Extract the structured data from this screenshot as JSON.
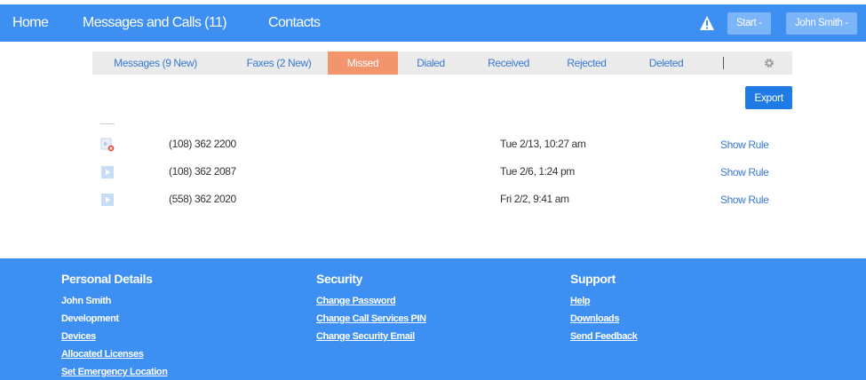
{
  "nav": {
    "home": "Home",
    "messages_calls": "Messages and Calls (11)",
    "contacts": "Contacts",
    "start_button": "Start -",
    "user_button": "John Smith -"
  },
  "tabs": {
    "messages": "Messages (9 New)",
    "faxes": "Faxes (2 New)",
    "missed": "Missed",
    "dialed": "Dialed",
    "received": "Received",
    "rejected": "Rejected",
    "deleted": "Deleted",
    "active": "Missed"
  },
  "export_label": "Export",
  "calls": [
    {
      "phone": "(108) 362 2200",
      "time": "Tue 2/13, 10:27 am",
      "action": "Show Rule",
      "icon": "missed-call-icon"
    },
    {
      "phone": "(108) 362 2087",
      "time": "Tue 2/6, 1:24 pm",
      "action": "Show Rule",
      "icon": "play-icon"
    },
    {
      "phone": "(558) 362 2020",
      "time": "Fri 2/2, 9:41 am",
      "action": "Show Rule",
      "icon": "play-icon"
    }
  ],
  "footer": {
    "personal": {
      "heading": "Personal Details",
      "name": "John Smith",
      "department": "Development",
      "links": [
        "Devices",
        "Allocated Licenses",
        "Set Emergency Location"
      ]
    },
    "security": {
      "heading": "Security",
      "links": [
        "Change Password",
        "Change Call Services PIN",
        "Change Security Email"
      ]
    },
    "support": {
      "heading": "Support",
      "links": [
        "Help",
        "Downloads",
        "Send Feedback"
      ]
    }
  },
  "colors": {
    "brand_blue": "#3d8ff2",
    "active_tab": "#f2946c",
    "link_blue": "#3a78d0",
    "export_blue": "#1f7be6"
  }
}
